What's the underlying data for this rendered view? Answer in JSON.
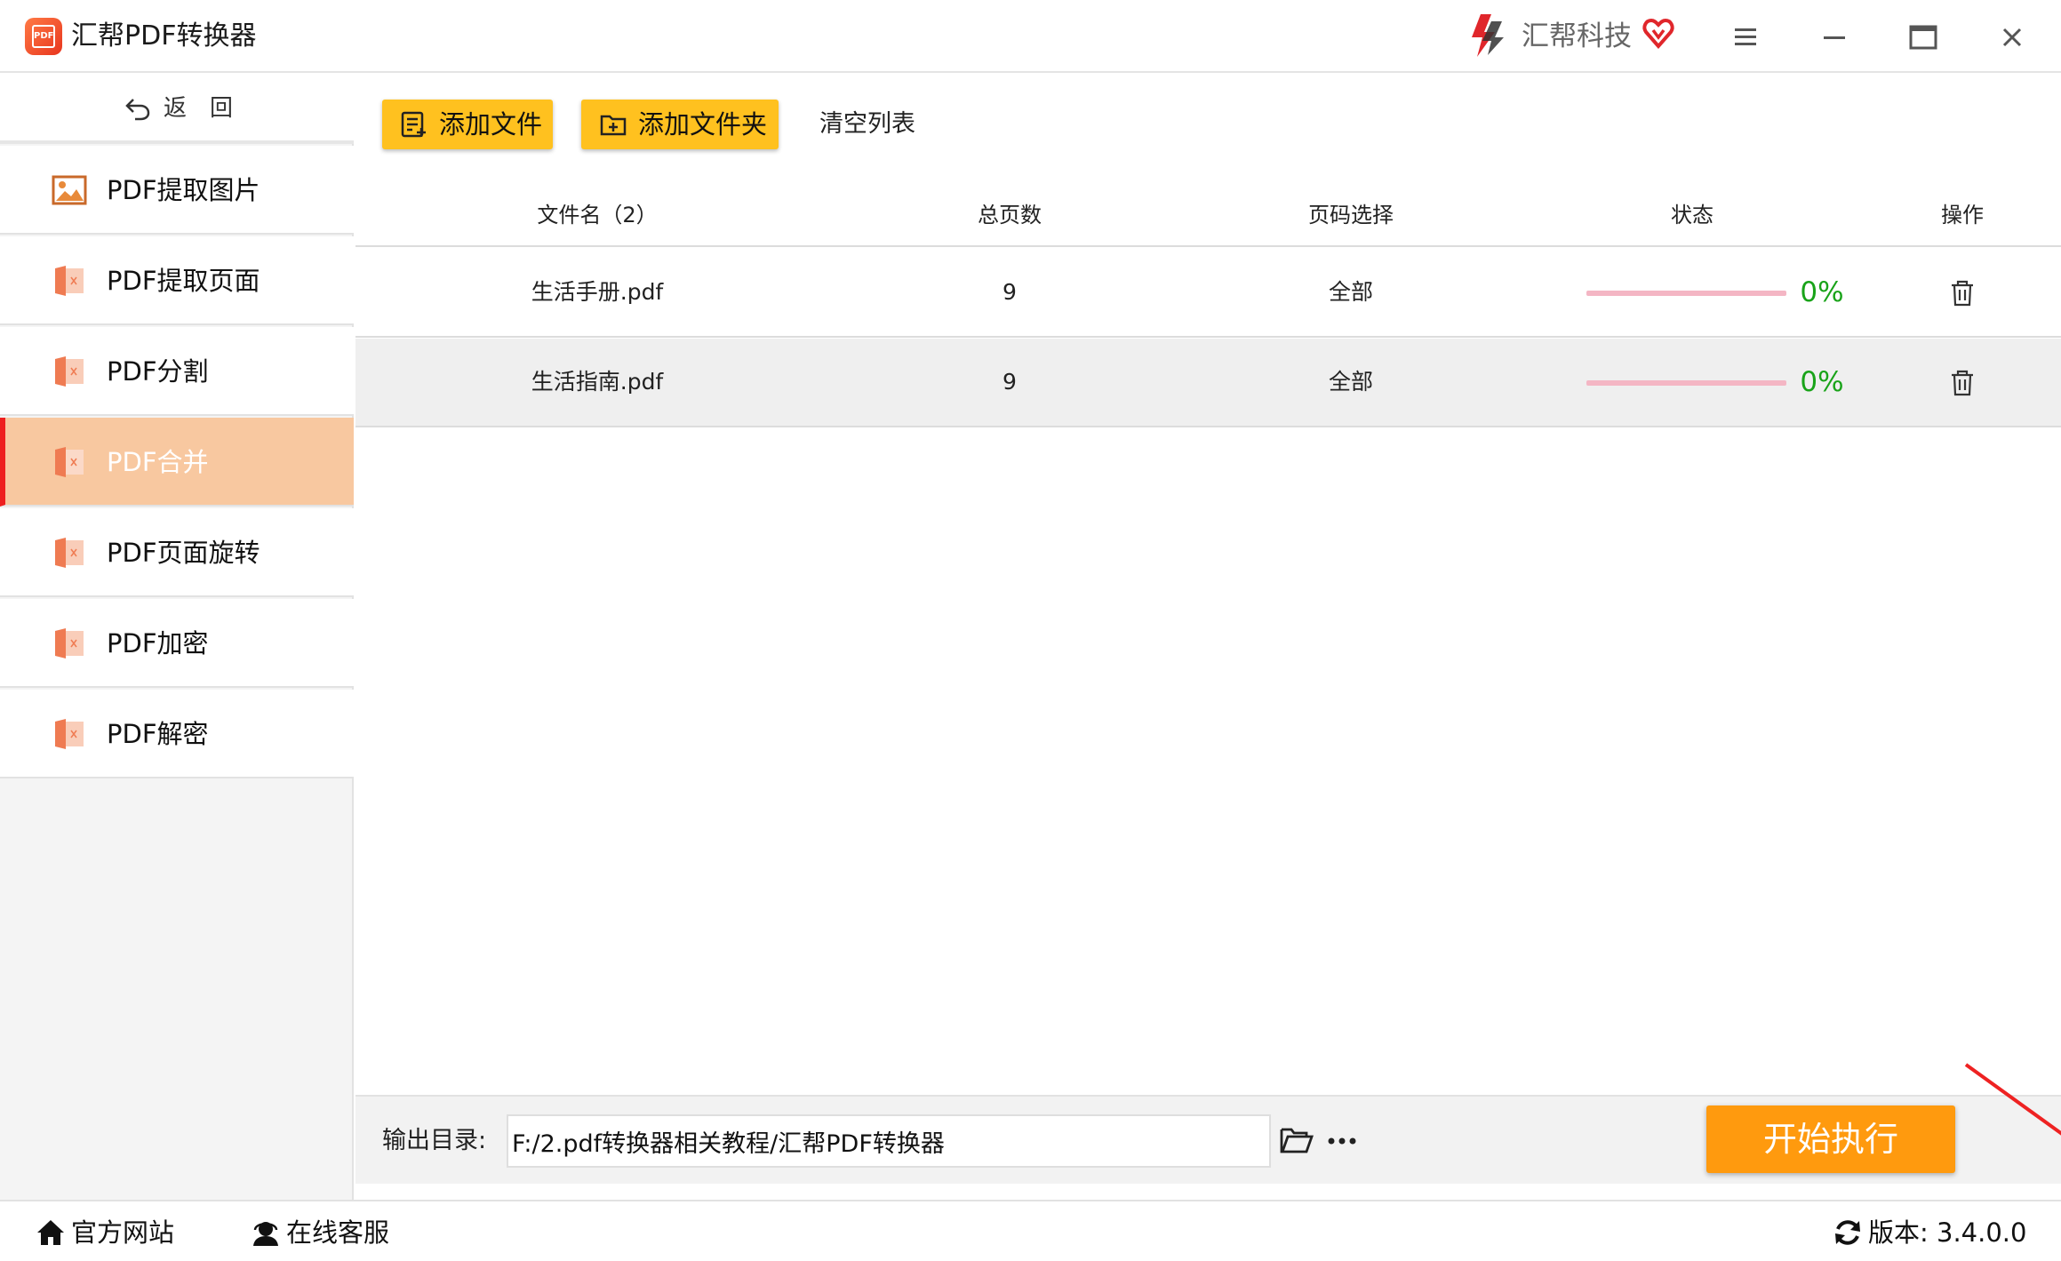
{
  "app": {
    "title": "汇帮PDF转换器",
    "brand": "汇帮科技",
    "logo_text": "PDF"
  },
  "sidebar": {
    "back_label": "返回",
    "items": [
      {
        "label": "PDF提取图片",
        "icon": "image-icon",
        "active": false
      },
      {
        "label": "PDF提取页面",
        "icon": "pdf-file-icon",
        "active": false
      },
      {
        "label": "PDF分割",
        "icon": "pdf-file-icon",
        "active": false
      },
      {
        "label": "PDF合并",
        "icon": "pdf-file-icon",
        "active": true
      },
      {
        "label": "PDF页面旋转",
        "icon": "pdf-file-icon",
        "active": false
      },
      {
        "label": "PDF加密",
        "icon": "pdf-file-icon",
        "active": false
      },
      {
        "label": "PDF解密",
        "icon": "pdf-file-icon",
        "active": false
      }
    ]
  },
  "toolbar": {
    "add_file": "添加文件",
    "add_folder": "添加文件夹",
    "clear_list": "清空列表"
  },
  "table": {
    "headers": {
      "filename": "文件名（2）",
      "total_pages": "总页数",
      "page_select": "页码选择",
      "status": "状态",
      "action": "操作"
    },
    "rows": [
      {
        "filename": "生活手册.pdf",
        "pages": "9",
        "range": "全部",
        "progress": 0,
        "percent": "0%"
      },
      {
        "filename": "生活指南.pdf",
        "pages": "9",
        "range": "全部",
        "progress": 0,
        "percent": "0%"
      }
    ]
  },
  "output": {
    "label": "输出目录:",
    "path": "F:/2.pdf转换器相关教程/汇帮PDF转换器",
    "start_button": "开始执行"
  },
  "statusbar": {
    "website": "官方网站",
    "support": "在线客服",
    "version": "版本:  3.4.0.0"
  },
  "colors": {
    "accent_yellow": "#ffc11f",
    "start_orange": "#ff9a0e",
    "active_nav": "#f8c8a0",
    "active_marker": "#ee1f1f",
    "progress_track": "#f4b6c4",
    "percent_green": "#19a319"
  }
}
